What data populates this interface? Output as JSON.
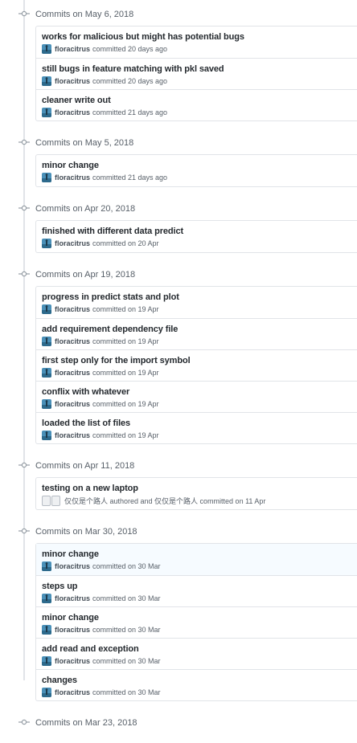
{
  "groups": [
    {
      "title": "Commits on May 6, 2018",
      "commits": [
        {
          "message": "works for malicious but might has potential bugs",
          "author": "floracitrus",
          "meta": "committed 20 days ago"
        },
        {
          "message": "still bugs in feature matching with pkl saved",
          "author": "floracitrus",
          "meta": "committed 20 days ago"
        },
        {
          "message": "cleaner write out",
          "author": "floracitrus",
          "meta": "committed 21 days ago"
        }
      ]
    },
    {
      "title": "Commits on May 5, 2018",
      "commits": [
        {
          "message": "minor change",
          "author": "floracitrus",
          "meta": "committed 21 days ago"
        }
      ]
    },
    {
      "title": "Commits on Apr 20, 2018",
      "commits": [
        {
          "message": "finished with different data predict",
          "author": "floracitrus",
          "meta": "committed on 20 Apr"
        }
      ]
    },
    {
      "title": "Commits on Apr 19, 2018",
      "commits": [
        {
          "message": "progress in predict stats and plot",
          "author": "floracitrus",
          "meta": "committed on 19 Apr"
        },
        {
          "message": "add requirement dependency file",
          "author": "floracitrus",
          "meta": "committed on 19 Apr"
        },
        {
          "message": "first step only for the import symbol",
          "author": "floracitrus",
          "meta": "committed on 19 Apr"
        },
        {
          "message": "conflix with whatever",
          "author": "floracitrus",
          "meta": "committed on 19 Apr"
        },
        {
          "message": "loaded the list of files",
          "author": "floracitrus",
          "meta": "committed on 19 Apr"
        }
      ]
    },
    {
      "title": "Commits on Apr 11, 2018",
      "commits": [
        {
          "message": "testing on a new laptop",
          "author": "",
          "meta": "仅仅是个路人 authored and 仅仅是个路人 committed on 11 Apr",
          "ghost": true
        }
      ]
    },
    {
      "title": "Commits on Mar 30, 2018",
      "commits": [
        {
          "message": "minor change",
          "author": "floracitrus",
          "meta": "committed on 30 Mar",
          "highlighted": true
        },
        {
          "message": "steps up",
          "author": "floracitrus",
          "meta": "committed on 30 Mar"
        },
        {
          "message": "minor change",
          "author": "floracitrus",
          "meta": "committed on 30 Mar"
        },
        {
          "message": "add read and exception",
          "author": "floracitrus",
          "meta": "committed on 30 Mar"
        },
        {
          "message": "changes",
          "author": "floracitrus",
          "meta": "committed on 30 Mar"
        }
      ]
    },
    {
      "title": "Commits on Mar 23, 2018",
      "commits": []
    }
  ],
  "colors": {
    "timeline": "#e1e4e8",
    "border": "#e1e4e8",
    "highlight": "#f6fbff",
    "text": "#24292e",
    "muted": "#586069"
  },
  "icons": {
    "group": "git-commit-icon",
    "avatar": "user-avatar",
    "ghost": "ghost-avatar-icon"
  }
}
